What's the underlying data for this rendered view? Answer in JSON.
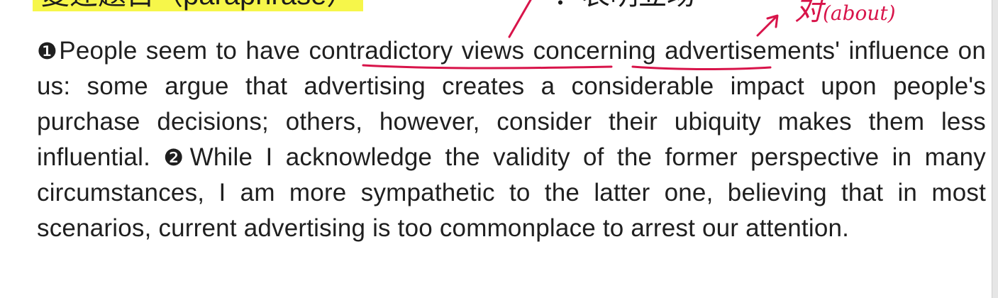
{
  "heading": {
    "title_text": "复述题目（paraphrase）",
    "tail_text": "：表明立场"
  },
  "annotation": {
    "note_char": "对",
    "note_paren": "(about)"
  },
  "passage": {
    "p1_num": "❶",
    "p1_start": "People seem to have ",
    "p1_phrase1": "contradictory views",
    "p1_sp": " ",
    "p1_phrase2": "concerning",
    "p1_rest": " advertisements' influence on us: some argue that advertising creates a considerable impact upon people's purchase decisions; others, however, consider their ubiquity makes them less influential. ",
    "p2_num": "❷",
    "p2_text": "While I acknowledge the validity of the former perspective in many circumstances, I am more sympathetic to the latter one, believing that in most scenarios, current advertising is too commonplace to arrest our attention."
  },
  "colors": {
    "highlight": "#f6f64a",
    "ink": "#d8144a",
    "text": "#1f1f1f"
  }
}
